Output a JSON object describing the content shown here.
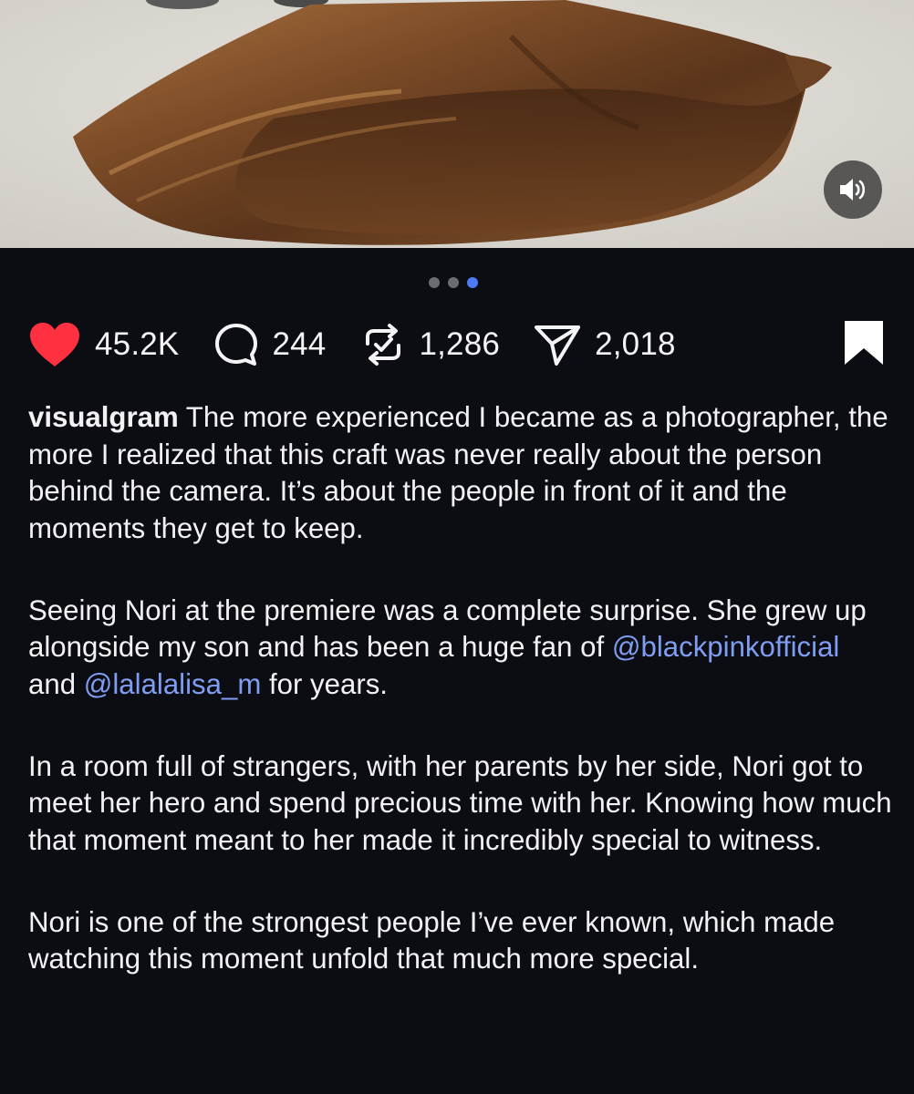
{
  "post": {
    "indicator": {
      "count": 3,
      "active_index": 2
    },
    "actions": {
      "like": {
        "icon": "heart-icon",
        "count": "45.2K",
        "color": "#ff3040"
      },
      "comment": {
        "icon": "comment-bubble-icon",
        "count": "244"
      },
      "repost": {
        "icon": "repost-icon",
        "count": "1,286"
      },
      "share": {
        "icon": "paper-plane-icon",
        "count": "2,018"
      },
      "save": {
        "icon": "bookmark-filled-icon"
      }
    },
    "media": {
      "sound_icon": "speaker-on-icon"
    },
    "caption": {
      "username": "visualgram",
      "p1": " The more experienced I became as a photographer, the more I realized that this craft was never really about the person behind the camera. It’s about the people in front of it and the moments they get to keep.",
      "p2_a": "Seeing Nori at the premiere was a complete surprise. She grew up alongside my son and has been a huge fan of ",
      "mention_1": "@blackpinkofficial",
      "p2_b": " and ",
      "mention_2": "@lalalalisa_m",
      "p2_c": " for years.",
      "p3": "In a room full of strangers, with her parents by her side, Nori got to meet her hero and spend precious time with her. Knowing how much that moment meant to her made it incredibly special to witness.",
      "p4": "Nori is one of the strongest people I’ve ever known, which made watching this moment unfold that much more special."
    },
    "colors": {
      "background": "#0c0d12",
      "mention": "#7f9df2",
      "active_dot": "#4c7bf5"
    }
  }
}
